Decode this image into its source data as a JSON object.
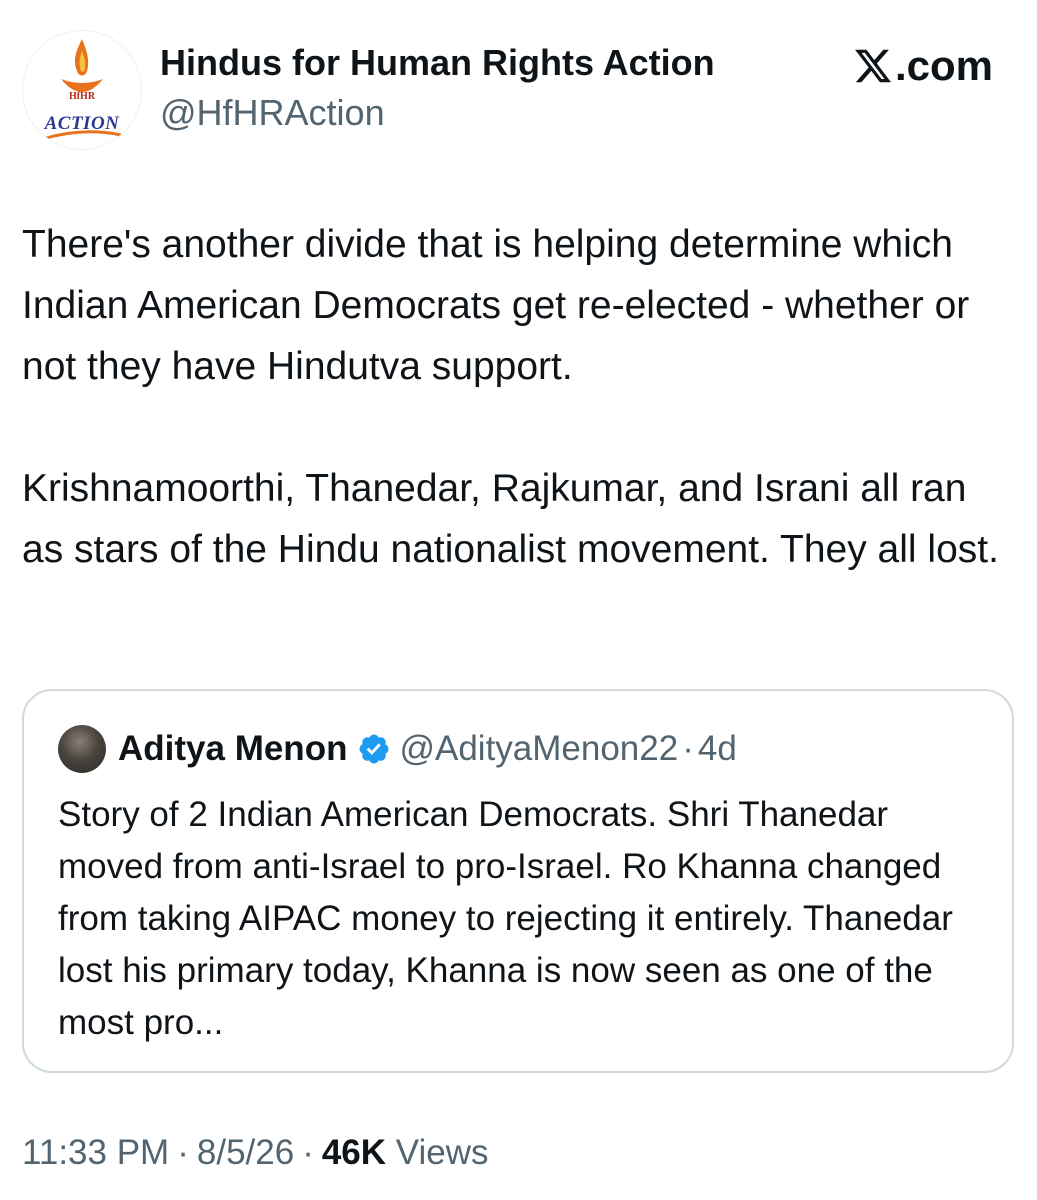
{
  "author": {
    "display_name": "Hindus for Human Rights Action",
    "handle": "@HfHRAction",
    "avatar_icon": "hfhr-action-logo-icon",
    "avatar_logo_small": "HfHR",
    "avatar_logo_text": "ACTION"
  },
  "brand": {
    "label": ".com",
    "icon": "x-logo-icon"
  },
  "tweet": {
    "paragraph_1": "There's another divide that is helping determine which Indian American Democrats get re-elected - whether or not they have Hindutva support.",
    "paragraph_2": "Krishnamoorthi, Thanedar, Rajkumar, and Israni all ran as stars of the Hindu nationalist movement. They all lost."
  },
  "quoted_tweet": {
    "author_name": "Aditya Menon",
    "verified_icon": "verified-badge-icon",
    "handle": "@AdityaMenon22",
    "separator": "·",
    "time": "4d",
    "text": "Story of 2 Indian American Democrats. Shri Thanedar moved from anti-Israel to pro-Israel. Ro Khanna changed from taking AIPAC money to rejecting it entirely. Thanedar lost his primary today, Khanna is now seen as one of the most pro..."
  },
  "meta": {
    "time": "11:33 PM",
    "sep1": "·",
    "date": "8/5/26",
    "sep2": "·",
    "views_count": "46K",
    "views_label": "Views"
  },
  "colors": {
    "text_primary": "#0f1419",
    "text_secondary": "#536471",
    "border": "#cfd9de",
    "verified_blue": "#1d9bf0"
  }
}
